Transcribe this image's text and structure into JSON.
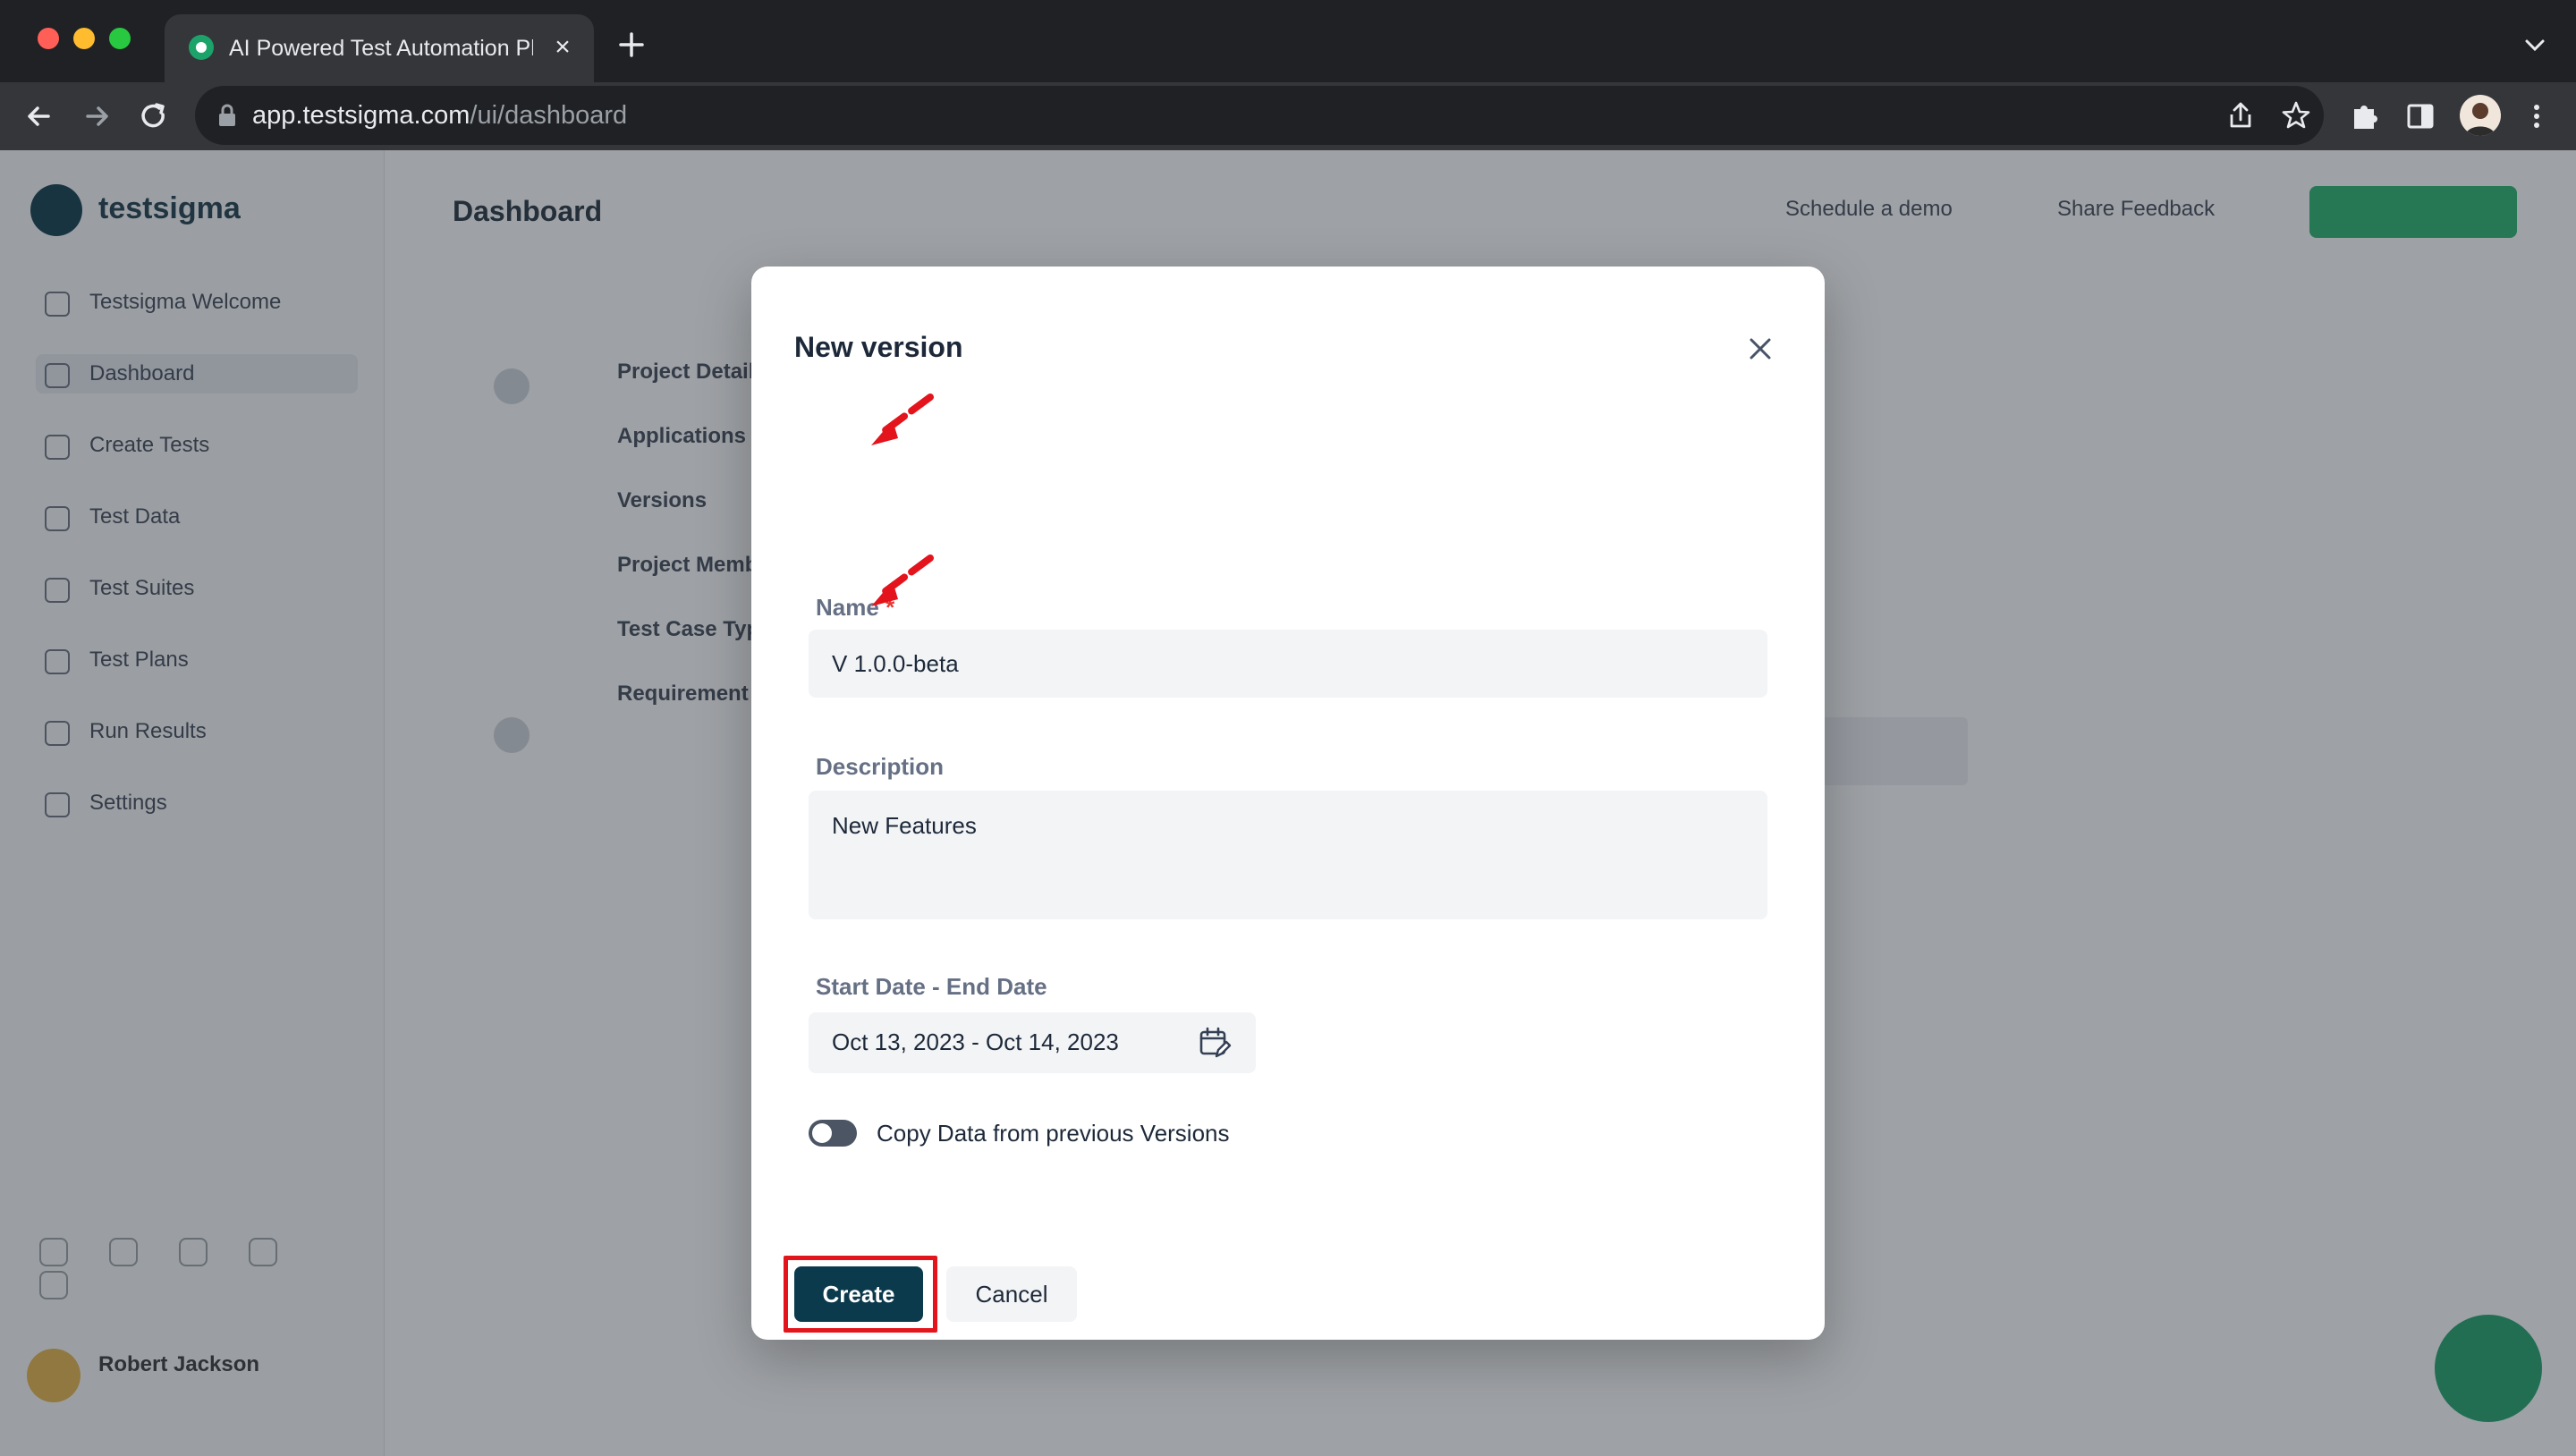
{
  "browser": {
    "tab_title": "AI Powered Test Automation Platform",
    "url_host": "app.testsigma.com",
    "url_path": "/ui/dashboard"
  },
  "app": {
    "logo_text": "testsigma",
    "header_title": "Dashboard",
    "header_links": [
      "Schedule a demo",
      "Share Feedback"
    ],
    "sidebar_items": [
      "Testsigma Welcome",
      "Dashboard",
      "Create Tests",
      "Test Data",
      "Test Suites",
      "Test Plans",
      "Run Results",
      "Settings"
    ],
    "user_name": "Robert Jackson"
  },
  "background_modal": {
    "labels": [
      "Project Details",
      "Applications",
      "Versions",
      "Project Members",
      "Test Case Types",
      "Requirement Types"
    ]
  },
  "dialog": {
    "title": "New version",
    "name_label": "Name",
    "required_mark": "*",
    "name_value": "V 1.0.0-beta",
    "description_label": "Description",
    "description_value": "New Features",
    "date_label": "Start Date - End Date",
    "date_value": "Oct 13, 2023 - Oct 14, 2023",
    "copy_toggle_label": "Copy Data from previous Versions",
    "copy_toggle_on": false,
    "create_label": "Create",
    "cancel_label": "Cancel"
  },
  "colors": {
    "primary_button": "#0b3a4d",
    "annotation_red": "#e3141b",
    "brand_green": "#25b26b"
  },
  "icons": [
    "close-icon",
    "calendar-edit-icon",
    "lock-icon",
    "share-icon",
    "star-icon",
    "puzzle-icon",
    "sidepanel-icon",
    "kebab-menu-icon",
    "back-arrow-icon",
    "forward-arrow-icon",
    "reload-icon",
    "plus-icon",
    "chevron-down-icon"
  ]
}
